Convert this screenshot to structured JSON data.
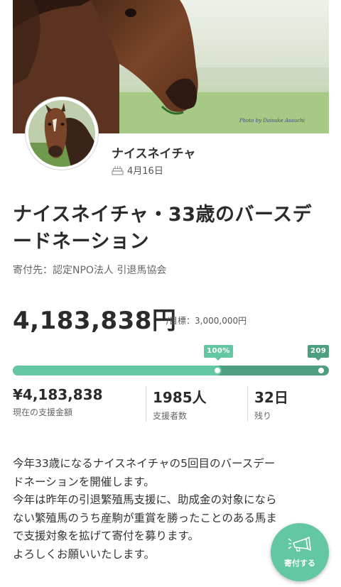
{
  "hero": {
    "photo_credit": "Photo by Daisuke Asauchi"
  },
  "profile": {
    "name": "ナイスネイチャ",
    "birthday_icon": "cake-icon",
    "birthday": "4月16日"
  },
  "project": {
    "title_line1": "ナイスネイチャ・33歳のバースデ",
    "title_line2": "ードネーション",
    "recipient": "寄付先：認定NPO法人 引退馬協会"
  },
  "funding": {
    "amount": "4,183,838円",
    "target": "/目標：3,000,000円",
    "progress_label": "100%",
    "progress_fraction": 1.0,
    "extra_label": "209",
    "colors": {
      "primary": "#63c7a1",
      "secondary": "#4e9e80"
    }
  },
  "stats": [
    {
      "value": "¥4,183,838",
      "label": "現在の支援金額"
    },
    {
      "value": "1985人",
      "label": "支援者数"
    },
    {
      "value": "32日",
      "label": "残り"
    }
  ],
  "description": [
    "今年33歳になるナイスネイチャの5回目のバースデー",
    "ドネーションを開催します。",
    "今年は昨年の引退繁殖馬支援に、助成金の対象になら",
    "ない繁殖馬のうち産駒が重賞を勝ったことのある馬ま",
    "で支援対象を拡げて寄付を募ります。",
    "よろしくお願いいたします。"
  ],
  "donate_button": {
    "icon": "megaphone-icon",
    "label": "寄付する"
  }
}
